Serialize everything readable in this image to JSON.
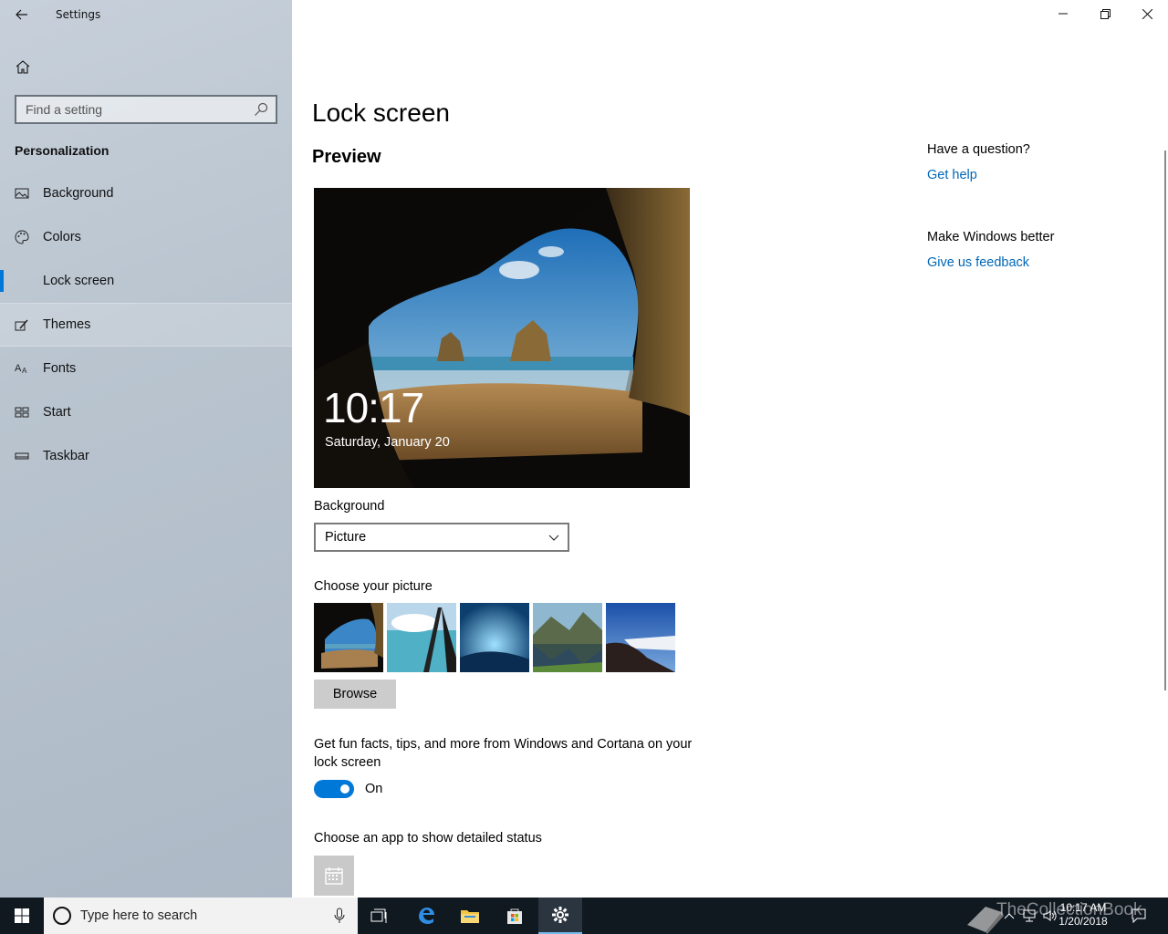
{
  "window": {
    "title": "Settings"
  },
  "search": {
    "placeholder": "Find a setting"
  },
  "sidebar": {
    "section": "Personalization",
    "items": [
      {
        "label": "Background",
        "icon": "picture-icon"
      },
      {
        "label": "Colors",
        "icon": "palette-icon"
      },
      {
        "label": "Lock screen",
        "icon": "lock-screen-icon",
        "active": true
      },
      {
        "label": "Themes",
        "icon": "brush-icon"
      },
      {
        "label": "Fonts",
        "icon": "font-icon"
      },
      {
        "label": "Start",
        "icon": "start-icon"
      },
      {
        "label": "Taskbar",
        "icon": "taskbar-icon"
      }
    ]
  },
  "main": {
    "title": "Lock screen",
    "preview_title": "Preview",
    "preview": {
      "time": "10:17",
      "date": "Saturday, January 20"
    },
    "background_label": "Background",
    "background_value": "Picture",
    "choose_picture_label": "Choose your picture",
    "browse_label": "Browse",
    "facts_text": "Get fun facts, tips, and more from Windows and Cortana on your lock screen",
    "toggle_state": "On",
    "status_label": "Choose an app to show detailed status"
  },
  "help": {
    "question": "Have a question?",
    "get_help": "Get help",
    "better": "Make Windows better",
    "feedback": "Give us feedback"
  },
  "taskbar": {
    "search_placeholder": "Type here to search",
    "time": "10:17 AM",
    "date": "1/20/2018",
    "watermark": "TheCollectionBook"
  },
  "colors": {
    "accent": "#0078d7",
    "link": "#0067b8"
  }
}
